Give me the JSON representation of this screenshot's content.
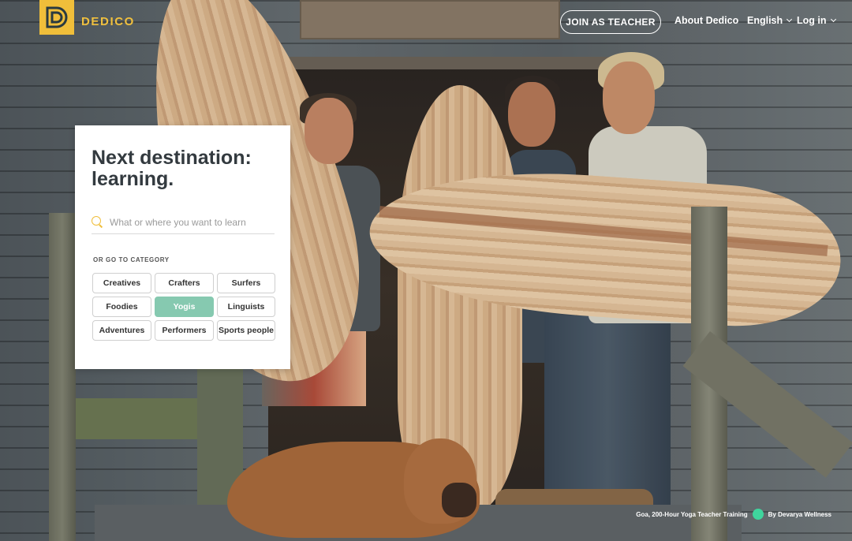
{
  "brand": {
    "name": "DEDICO",
    "accent_color": "#f0be3a",
    "logo_icon": "dedico-logo-icon"
  },
  "nav": {
    "teacher_button": "JOIN AS TEACHER",
    "about": "About Dedico",
    "language": "English",
    "login": "Log in"
  },
  "hero": {
    "headline": "Next destination: learning.",
    "search_placeholder": "What or where you want to learn",
    "search_icon": "search-icon",
    "category_label": "OR GO TO CATEGORY",
    "categories": [
      {
        "label": "Creatives",
        "active": false
      },
      {
        "label": "Crafters",
        "active": false
      },
      {
        "label": "Surfers",
        "active": false
      },
      {
        "label": "Foodies",
        "active": false
      },
      {
        "label": "Yogis",
        "active": true
      },
      {
        "label": "Linguists",
        "active": false
      },
      {
        "label": "Adventures",
        "active": false
      },
      {
        "label": "Performers",
        "active": false
      },
      {
        "label": "Sports people",
        "active": false
      }
    ],
    "active_color": "#86c9b0"
  },
  "caption": {
    "course": "Goa, 200-Hour Yoga Teacher Training",
    "provider": "By Devarya Wellness",
    "dot_color": "#3fd59d"
  }
}
